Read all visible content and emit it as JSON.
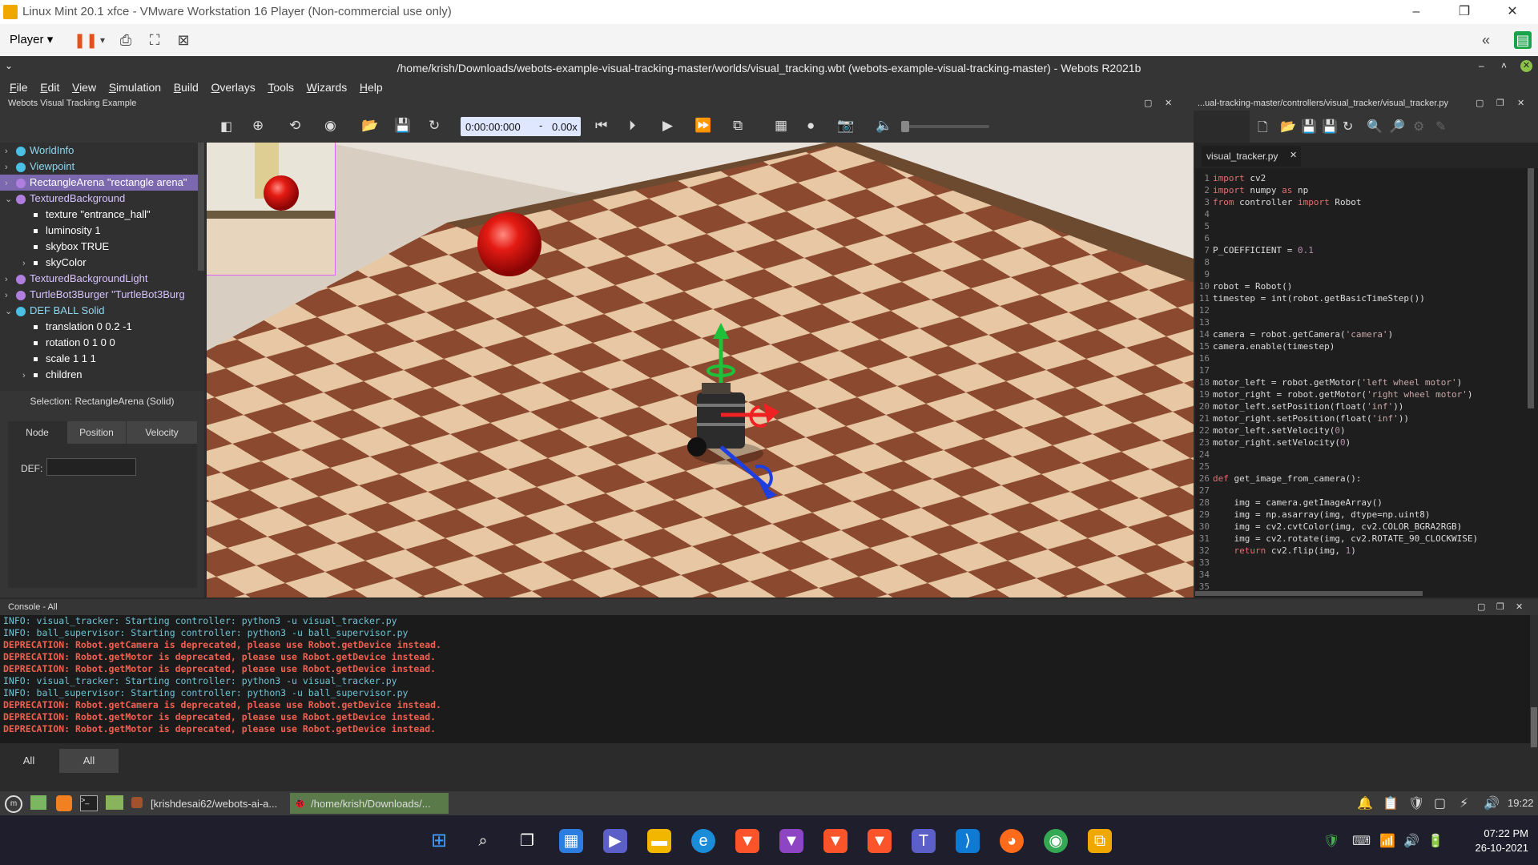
{
  "vm": {
    "title": "Linux Mint 20.1 xfce - VMware Workstation 16 Player (Non-commercial use only)",
    "player_label": "Player"
  },
  "webots": {
    "title": "/home/krish/Downloads/webots-example-visual-tracking-master/worlds/visual_tracking.wbt (webots-example-visual-tracking-master) - Webots R2021b",
    "menu": [
      "File",
      "Edit",
      "View",
      "Simulation",
      "Build",
      "Overlays",
      "Tools",
      "Wizards",
      "Help"
    ],
    "scene_title": "Webots Visual Tracking Example",
    "editor_path": "...ual-tracking-master/controllers/visual_tracker/visual_tracker.py",
    "time": "0:00:00:000",
    "speed": "0.00x"
  },
  "tree": [
    {
      "label": "WorldInfo",
      "color": "#49c0e4",
      "indent": 0,
      "expand": "›",
      "selected": false
    },
    {
      "label": "Viewpoint",
      "color": "#49c0e4",
      "indent": 0,
      "expand": "›",
      "selected": false
    },
    {
      "label": "RectangleArena \"rectangle arena\"",
      "color": "#b07ee0",
      "indent": 0,
      "expand": "›",
      "selected": true
    },
    {
      "label": "TexturedBackground",
      "color": "#b07ee0",
      "indent": 0,
      "expand": "⌄",
      "selected": false
    },
    {
      "label": "texture \"entrance_hall\"",
      "color": "",
      "indent": 1,
      "expand": "",
      "selected": false
    },
    {
      "label": "luminosity 1",
      "color": "",
      "indent": 1,
      "expand": "",
      "selected": false
    },
    {
      "label": "skybox TRUE",
      "color": "",
      "indent": 1,
      "expand": "",
      "selected": false
    },
    {
      "label": "skyColor",
      "color": "",
      "indent": 1,
      "expand": "›",
      "selected": false
    },
    {
      "label": "TexturedBackgroundLight",
      "color": "#b07ee0",
      "indent": 0,
      "expand": "›",
      "selected": false
    },
    {
      "label": "TurtleBot3Burger \"TurtleBot3Burg",
      "color": "#b07ee0",
      "indent": 0,
      "expand": "›",
      "selected": false
    },
    {
      "label": "DEF BALL Solid",
      "color": "#49c0e4",
      "indent": 0,
      "expand": "⌄",
      "selected": false
    },
    {
      "label": "translation 0 0.2 -1",
      "color": "",
      "indent": 1,
      "expand": "",
      "selected": false
    },
    {
      "label": "rotation 0 1 0 0",
      "color": "",
      "indent": 1,
      "expand": "",
      "selected": false
    },
    {
      "label": "scale 1 1 1",
      "color": "",
      "indent": 1,
      "expand": "",
      "selected": false
    },
    {
      "label": "children",
      "color": "",
      "indent": 1,
      "expand": "›",
      "selected": false
    }
  ],
  "props": {
    "selection": "Selection: RectangleArena (Solid)",
    "tabs": [
      "Node",
      "Position",
      "Velocity"
    ],
    "def_label": "DEF:"
  },
  "editor": {
    "tab": "visual_tracker.py",
    "lines": [
      [
        {
          "t": "import",
          "c": "kw"
        },
        {
          "t": " cv2",
          "c": ""
        }
      ],
      [
        {
          "t": "import",
          "c": "kw"
        },
        {
          "t": " numpy ",
          "c": ""
        },
        {
          "t": "as",
          "c": "kw"
        },
        {
          "t": " np",
          "c": ""
        }
      ],
      [
        {
          "t": "from",
          "c": "kw"
        },
        {
          "t": " controller ",
          "c": ""
        },
        {
          "t": "import",
          "c": "kw"
        },
        {
          "t": " Robot",
          "c": ""
        }
      ],
      [],
      [],
      [],
      [
        {
          "t": "P_COEFFICIENT = ",
          "c": ""
        },
        {
          "t": "0.1",
          "c": "num"
        }
      ],
      [],
      [],
      [
        {
          "t": "robot = Robot()",
          "c": ""
        }
      ],
      [
        {
          "t": "timestep = int(robot.getBasicTimeStep())",
          "c": ""
        }
      ],
      [],
      [],
      [
        {
          "t": "camera = robot.getCamera(",
          "c": ""
        },
        {
          "t": "'camera'",
          "c": "str"
        },
        {
          "t": ")",
          "c": ""
        }
      ],
      [
        {
          "t": "camera.enable(timestep)",
          "c": ""
        }
      ],
      [],
      [],
      [
        {
          "t": "motor_left = robot.getMotor(",
          "c": ""
        },
        {
          "t": "'left wheel motor'",
          "c": "str"
        },
        {
          "t": ")",
          "c": ""
        }
      ],
      [
        {
          "t": "motor_right = robot.getMotor(",
          "c": ""
        },
        {
          "t": "'right wheel motor'",
          "c": "str"
        },
        {
          "t": ")",
          "c": ""
        }
      ],
      [
        {
          "t": "motor_left.setPosition(float(",
          "c": ""
        },
        {
          "t": "'inf'",
          "c": "str"
        },
        {
          "t": "))",
          "c": ""
        }
      ],
      [
        {
          "t": "motor_right.setPosition(float(",
          "c": ""
        },
        {
          "t": "'inf'",
          "c": "str"
        },
        {
          "t": "))",
          "c": ""
        }
      ],
      [
        {
          "t": "motor_left.setVelocity(",
          "c": ""
        },
        {
          "t": "0",
          "c": "num"
        },
        {
          "t": ")",
          "c": ""
        }
      ],
      [
        {
          "t": "motor_right.setVelocity(",
          "c": ""
        },
        {
          "t": "0",
          "c": "num"
        },
        {
          "t": ")",
          "c": ""
        }
      ],
      [],
      [],
      [
        {
          "t": "def",
          "c": "kw"
        },
        {
          "t": " get_image_from_camera():",
          "c": ""
        }
      ],
      [],
      [
        {
          "t": "    img = camera.getImageArray()",
          "c": ""
        }
      ],
      [
        {
          "t": "    img = np.asarray(img, dtype=np.uint8)",
          "c": ""
        }
      ],
      [
        {
          "t": "    img = cv2.cvtColor(img, cv2.COLOR_BGRA2RGB)",
          "c": ""
        }
      ],
      [
        {
          "t": "    img = cv2.rotate(img, cv2.ROTATE_90_CLOCKWISE)",
          "c": ""
        }
      ],
      [
        {
          "t": "    ",
          "c": ""
        },
        {
          "t": "return",
          "c": "kw"
        },
        {
          "t": " cv2.flip(img, ",
          "c": ""
        },
        {
          "t": "1",
          "c": "num"
        },
        {
          "t": ")",
          "c": ""
        }
      ],
      [],
      [],
      []
    ]
  },
  "console": {
    "title": "Console - All",
    "lines": [
      {
        "text": "INFO: visual_tracker: Starting controller: python3 -u visual_tracker.py",
        "type": "info"
      },
      {
        "text": "INFO: ball_supervisor: Starting controller: python3 -u ball_supervisor.py",
        "type": "info"
      },
      {
        "text": "DEPRECATION: Robot.getCamera is deprecated, please use Robot.getDevice instead.",
        "type": "dep"
      },
      {
        "text": "DEPRECATION: Robot.getMotor is deprecated, please use Robot.getDevice instead.",
        "type": "dep"
      },
      {
        "text": "DEPRECATION: Robot.getMotor is deprecated, please use Robot.getDevice instead.",
        "type": "dep"
      },
      {
        "text": "INFO: visual_tracker: Starting controller: python3 -u visual_tracker.py",
        "type": "info"
      },
      {
        "text": "INFO: ball_supervisor: Starting controller: python3 -u ball_supervisor.py",
        "type": "info"
      },
      {
        "text": "DEPRECATION: Robot.getCamera is deprecated, please use Robot.getDevice instead.",
        "type": "dep"
      },
      {
        "text": "DEPRECATION: Robot.getMotor is deprecated, please use Robot.getDevice instead.",
        "type": "dep"
      },
      {
        "text": "DEPRECATION: Robot.getMotor is deprecated, please use Robot.getDevice instead.",
        "type": "dep"
      }
    ],
    "tabs": [
      "All",
      "All"
    ]
  },
  "xfce": {
    "task1": "[krishdesai62/webots-ai-a...",
    "task2": "/home/krish/Downloads/...",
    "clock": "19:22"
  },
  "windows": {
    "time": "07:22 PM",
    "date": "26-10-2021"
  },
  "colors": {
    "selection": "#7b68ae",
    "info": "#6ec3d6",
    "deprecation": "#f06050"
  }
}
